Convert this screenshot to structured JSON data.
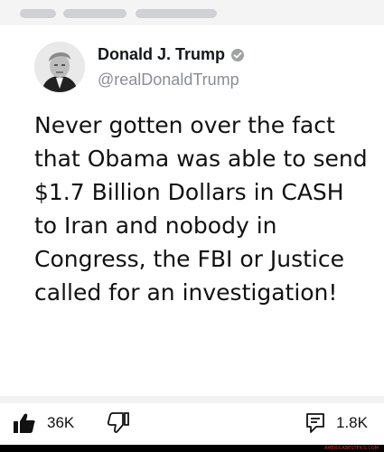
{
  "tweet": {
    "author_name": "Donald J. Trump",
    "handle": "@realDonaldTrump",
    "text": "Never gotten over the fact that Obama was able to send $1.7 Billion Dollars in CASH to Iran and nobody in Congress, the FBI or Justice called for an investigation!"
  },
  "actions": {
    "like_count": "36K",
    "comment_count": "1.8K"
  },
  "icons": {
    "avatar": "profile-photo",
    "verified": "verified-badge-icon",
    "like": "thumbs-up-icon",
    "dislike": "thumbs-down-icon",
    "comment": "comment-icon"
  },
  "colors": {
    "handle": "#8a8d91",
    "verified": "#9ea2a7",
    "watermark": "#c43a2a"
  },
  "watermark": "AMERICABESTPICS.COM"
}
